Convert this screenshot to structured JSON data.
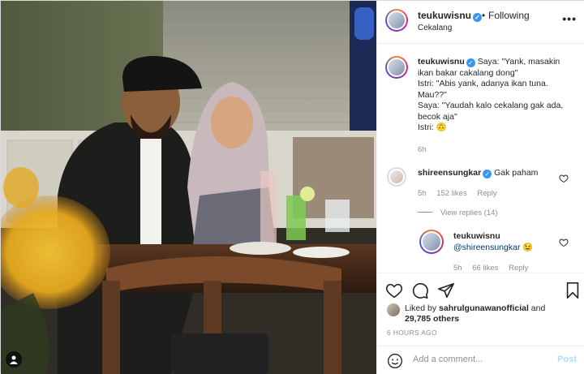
{
  "post": {
    "username": "teukuwisnu",
    "follow_status": "Following",
    "location": "Cekalang",
    "more_label": "•••"
  },
  "caption": {
    "username": "teukuwisnu",
    "lines": [
      "Saya: \"Yank, masakin",
      "ikan bakar cakalang dong\"",
      "Istri: \"Abis yank, adanya ikan tuna.",
      "Mau??\"",
      "Saya: \"Yaudah kalo cekalang gak ada,",
      "becok aja\"",
      "Istri: 🙃"
    ],
    "time": "6h"
  },
  "comments": [
    {
      "username": "shireensungkar",
      "text": "Gak paham",
      "time": "5h",
      "likes": "152 likes",
      "reply": "Reply"
    }
  ],
  "view_replies": "View replies (14)",
  "reply": {
    "username": "teukuwisnu",
    "mention": "@shireensungkar",
    "emoji": "😉",
    "time": "5h",
    "likes": "66 likes",
    "reply": "Reply"
  },
  "likes": {
    "prefix": "Liked by ",
    "user": "sahrulgunawanofficial",
    "middle": " and",
    "count": "29,785 others"
  },
  "timestamp": "6 HOURS AGO",
  "add_comment": {
    "placeholder": "Add a comment...",
    "post": "Post"
  },
  "colors": {
    "verified": "#3897f0",
    "post_button": "#b2dffc",
    "text": "#262626",
    "muted": "#8e8e8e"
  }
}
